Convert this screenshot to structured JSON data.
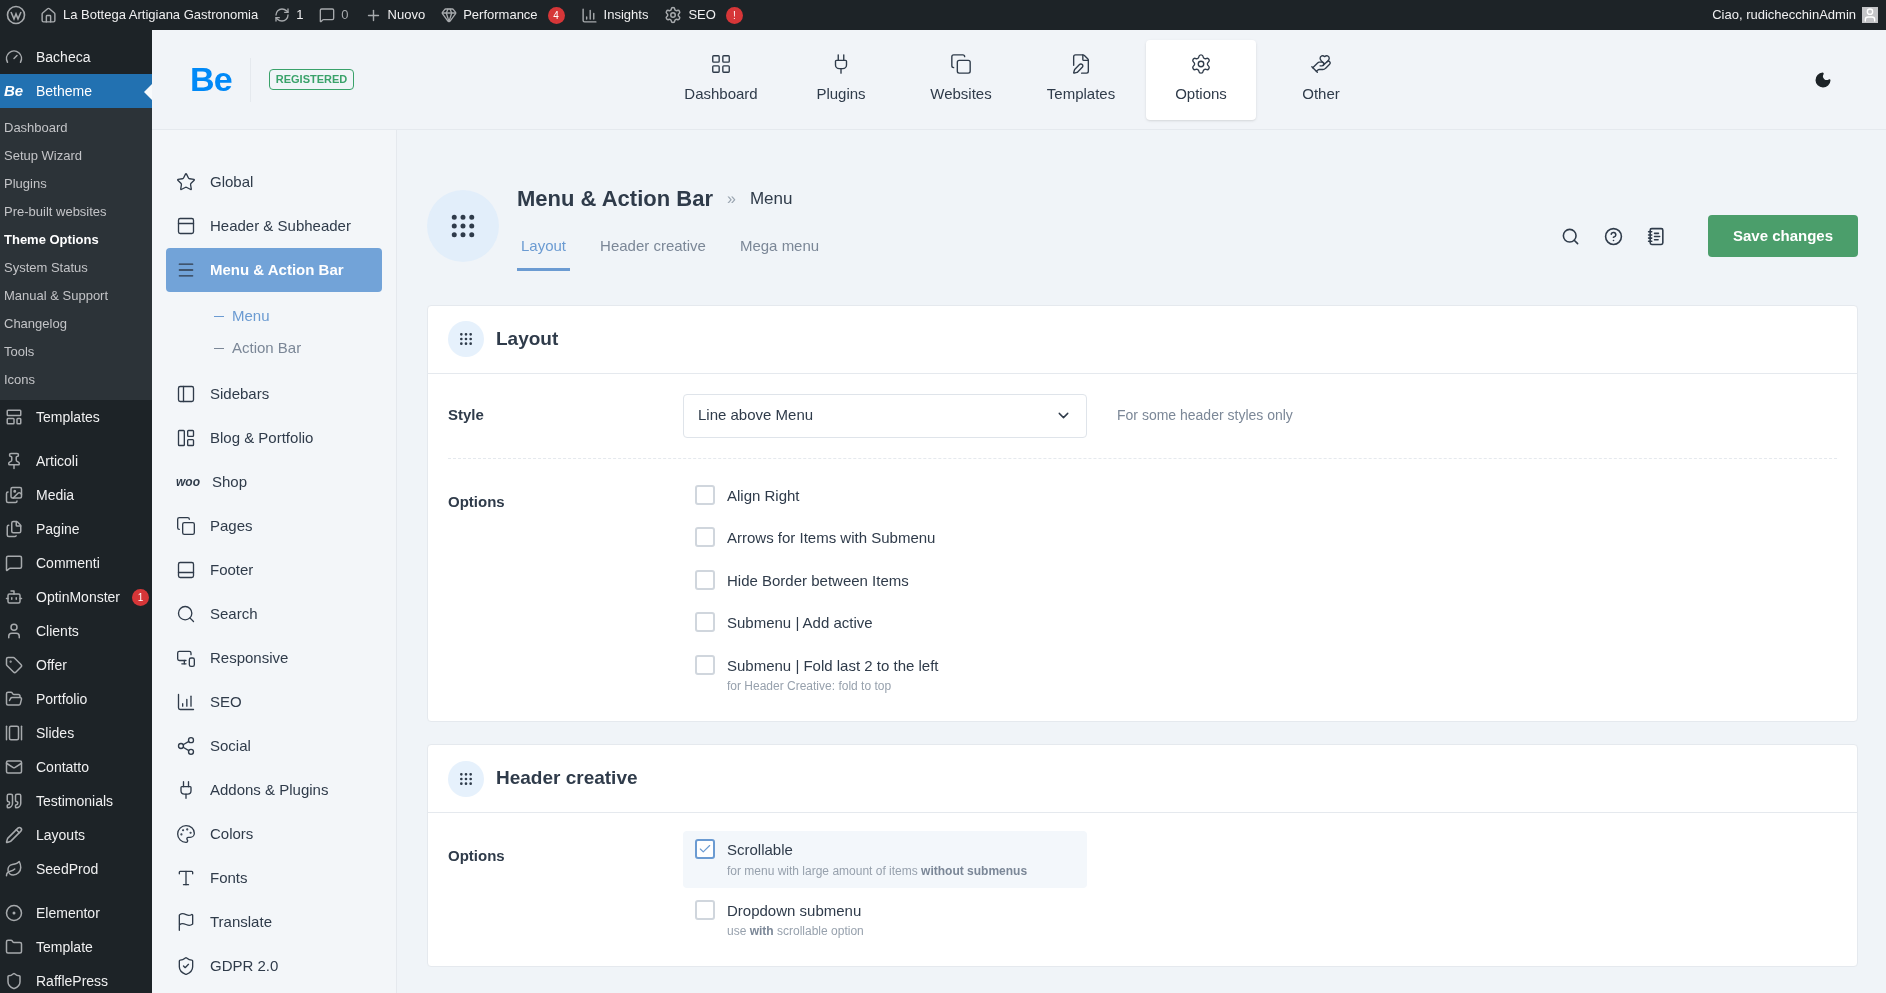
{
  "admin_bar": {
    "site": "La Bottega Artigiana Gastronomia",
    "updates": "1",
    "comments": "0",
    "new": "Nuovo",
    "performance": {
      "label": "Performance",
      "badge": "4"
    },
    "insights": "Insights",
    "seo": {
      "label": "SEO",
      "badge": "!"
    },
    "greeting": "Ciao, rudichecchinAdmin"
  },
  "wp_menu": [
    {
      "label": "Bacheca",
      "selected": false,
      "separator_before": false
    },
    {
      "label": "Betheme",
      "logo": "Be",
      "selected": true,
      "separator_before": false,
      "submenu": [
        {
          "label": "Dashboard",
          "selected": false
        },
        {
          "label": "Setup Wizard",
          "selected": false
        },
        {
          "label": "Plugins",
          "selected": false
        },
        {
          "label": "Pre-built websites",
          "selected": false
        },
        {
          "label": "Theme Options",
          "selected": true
        },
        {
          "label": "System Status",
          "selected": false
        },
        {
          "label": "Manual & Support",
          "selected": false
        },
        {
          "label": "Changelog",
          "selected": false
        },
        {
          "label": "Tools",
          "selected": false
        },
        {
          "label": "Icons",
          "selected": false
        }
      ]
    },
    {
      "label": "Templates",
      "selected": false,
      "separator_before": false
    },
    {
      "label": "Articoli",
      "selected": false,
      "separator_before": true
    },
    {
      "label": "Media",
      "selected": false,
      "separator_before": false
    },
    {
      "label": "Pagine",
      "selected": false,
      "separator_before": false
    },
    {
      "label": "Commenti",
      "selected": false,
      "separator_before": false
    },
    {
      "label": "OptinMonster",
      "badge": "1",
      "selected": false,
      "separator_before": false
    },
    {
      "label": "Clients",
      "selected": false,
      "separator_before": false
    },
    {
      "label": "Offer",
      "selected": false,
      "separator_before": false
    },
    {
      "label": "Portfolio",
      "selected": false,
      "separator_before": false
    },
    {
      "label": "Slides",
      "selected": false,
      "separator_before": false
    },
    {
      "label": "Contatto",
      "selected": false,
      "separator_before": false
    },
    {
      "label": "Testimonials",
      "selected": false,
      "separator_before": false
    },
    {
      "label": "Layouts",
      "selected": false,
      "separator_before": false
    },
    {
      "label": "SeedProd",
      "selected": false,
      "separator_before": false
    },
    {
      "label": "Elementor",
      "selected": false,
      "separator_before": true
    },
    {
      "label": "Template",
      "selected": false,
      "separator_before": false
    },
    {
      "label": "RafflePress",
      "selected": false,
      "separator_before": false
    }
  ],
  "header": {
    "logo": "Be",
    "badge": "REGISTERED",
    "tabs": [
      {
        "label": "Dashboard",
        "selected": false
      },
      {
        "label": "Plugins",
        "selected": false
      },
      {
        "label": "Websites",
        "selected": false
      },
      {
        "label": "Templates",
        "selected": false
      },
      {
        "label": "Options",
        "selected": true
      },
      {
        "label": "Other",
        "selected": false
      }
    ]
  },
  "nav": [
    {
      "label": "Global",
      "selected": false
    },
    {
      "label": "Header & Subheader",
      "selected": false
    },
    {
      "label": "Menu & Action Bar",
      "selected": true,
      "children": [
        {
          "label": "Menu",
          "selected": true
        },
        {
          "label": "Action Bar",
          "selected": false
        }
      ]
    },
    {
      "label": "Sidebars",
      "selected": false
    },
    {
      "label": "Blog & Portfolio",
      "selected": false
    },
    {
      "label": "Shop",
      "logo": "woo",
      "selected": false
    },
    {
      "label": "Pages",
      "selected": false
    },
    {
      "label": "Footer",
      "selected": false
    },
    {
      "label": "Search",
      "selected": false
    },
    {
      "label": "Responsive",
      "selected": false
    },
    {
      "label": "SEO",
      "selected": false
    },
    {
      "label": "Social",
      "selected": false
    },
    {
      "label": "Addons & Plugins",
      "selected": false
    },
    {
      "label": "Colors",
      "selected": false
    },
    {
      "label": "Fonts",
      "selected": false
    },
    {
      "label": "Translate",
      "selected": false
    },
    {
      "label": "GDPR 2.0",
      "selected": false
    }
  ],
  "page": {
    "title": "Menu & Action Bar",
    "separator": "»",
    "crumb": "Menu",
    "tabs": [
      {
        "label": "Layout",
        "selected": true
      },
      {
        "label": "Header creative",
        "selected": false
      },
      {
        "label": "Mega menu",
        "selected": false
      }
    ],
    "save": "Save changes"
  },
  "sections": [
    {
      "title": "Layout",
      "rows": [
        {
          "kind": "select",
          "label": "Style",
          "value": "Line above Menu",
          "hint": "For some header styles only"
        },
        {
          "kind": "checkboxes",
          "label": "Options",
          "options": [
            {
              "label": "Align Right",
              "checked": false
            },
            {
              "label": "Arrows for Items with Submenu",
              "checked": false
            },
            {
              "label": "Hide Border between Items",
              "checked": false
            },
            {
              "label": "Submenu | Add active",
              "checked": false
            },
            {
              "label": "Submenu | Fold last 2 to the left",
              "checked": false,
              "note": "for Header Creative: fold to top"
            }
          ]
        }
      ]
    },
    {
      "title": "Header creative",
      "rows": [
        {
          "kind": "checkboxes",
          "label": "Options",
          "options": [
            {
              "label": "Scrollable",
              "checked": true,
              "note": "for menu with large amount of items **without submenus**"
            },
            {
              "label": "Dropdown submenu",
              "checked": false,
              "note": "use **with** scrollable option"
            }
          ]
        }
      ]
    }
  ]
}
